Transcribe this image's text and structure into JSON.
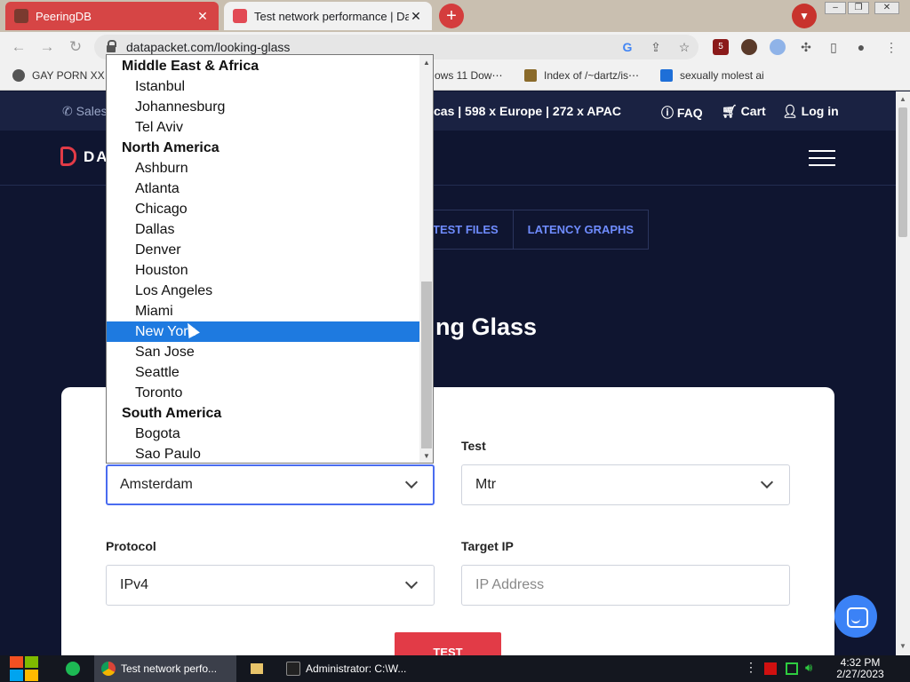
{
  "browser": {
    "tabs": [
      {
        "title": "PeeringDB",
        "close": "✕"
      },
      {
        "title": "Test network performance | Da",
        "close": "✕"
      }
    ],
    "new_tab": "+",
    "url": "datapacket.com/looking-glass",
    "bookmarks": [
      {
        "label": "GAY PORN XX"
      },
      {
        "label": "ows 11 Dow⋯"
      },
      {
        "label": "Index of /~dartz/is⋯"
      },
      {
        "label": "sexually molest ai"
      }
    ],
    "extension_badge": "5"
  },
  "site": {
    "top_info": {
      "sales": "Sales",
      "locations": "cas | 598 x Europe | 272 x APAC",
      "faq": "FAQ",
      "cart": "Cart",
      "login": "Log in"
    },
    "logo_text": "DA",
    "subnav": [
      "TEST FILES",
      "LATENCY GRAPHS"
    ],
    "heading": "ng Glass",
    "form": {
      "location": {
        "label": "",
        "value": "Amsterdam"
      },
      "test": {
        "label": "Test",
        "value": "Mtr"
      },
      "protocol": {
        "label": "Protocol",
        "value": "IPv4"
      },
      "target": {
        "label": "Target IP",
        "placeholder": "IP Address"
      },
      "submit": "TEST"
    }
  },
  "dropdown": {
    "options": [
      {
        "type": "group",
        "label": "Middle East & Africa"
      },
      {
        "type": "item",
        "label": "Istanbul"
      },
      {
        "type": "item",
        "label": "Johannesburg"
      },
      {
        "type": "item",
        "label": "Tel Aviv"
      },
      {
        "type": "group",
        "label": "North America"
      },
      {
        "type": "item",
        "label": "Ashburn"
      },
      {
        "type": "item",
        "label": "Atlanta"
      },
      {
        "type": "item",
        "label": "Chicago"
      },
      {
        "type": "item",
        "label": "Dallas"
      },
      {
        "type": "item",
        "label": "Denver"
      },
      {
        "type": "item",
        "label": "Houston"
      },
      {
        "type": "item",
        "label": "Los Angeles"
      },
      {
        "type": "item",
        "label": "Miami"
      },
      {
        "type": "item",
        "label": "New York",
        "selected": true
      },
      {
        "type": "item",
        "label": "San Jose"
      },
      {
        "type": "item",
        "label": "Seattle"
      },
      {
        "type": "item",
        "label": "Toronto"
      },
      {
        "type": "group",
        "label": "South America"
      },
      {
        "type": "item",
        "label": "Bogota"
      },
      {
        "type": "item",
        "label": "Sao Paulo"
      }
    ]
  },
  "taskbar": {
    "apps": [
      {
        "label": "Test network perfo..."
      },
      {
        "label": "Administrator: C:\\W..."
      }
    ],
    "time": "4:32 PM",
    "date": "2/27/2023"
  },
  "colors": {
    "brand_red": "#e23b47",
    "accent_blue": "#6f8cff",
    "selection_blue": "#1e7ae0",
    "page_bg": "#0f1530"
  }
}
